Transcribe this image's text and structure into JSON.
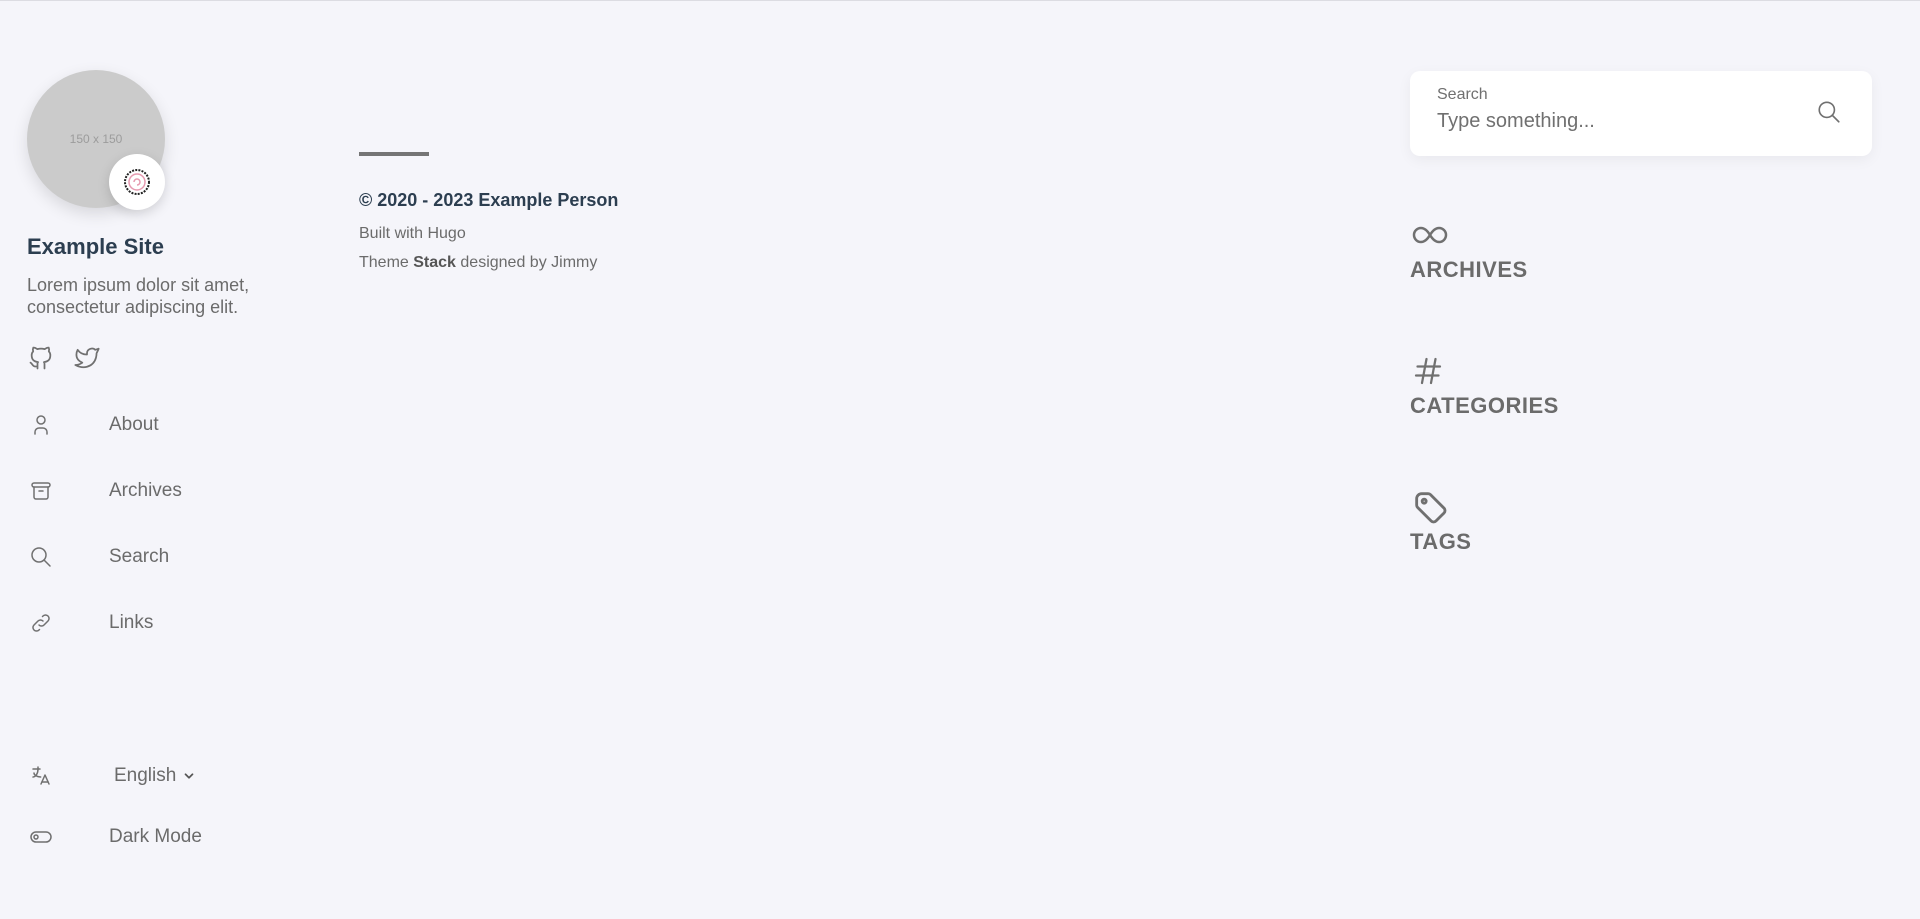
{
  "sidebar": {
    "avatar_placeholder": "150 x 150",
    "emoji_badge": "🍥",
    "site_name": "Example Site",
    "site_description": "Lorem ipsum dolor sit amet, consectetur adipiscing elit.",
    "social": [
      {
        "icon": "github-icon"
      },
      {
        "icon": "twitter-icon"
      }
    ],
    "menu": [
      {
        "label": "About",
        "icon": "user-icon"
      },
      {
        "label": "Archives",
        "icon": "archive-icon"
      },
      {
        "label": "Search",
        "icon": "search-icon"
      },
      {
        "label": "Links",
        "icon": "link-icon"
      }
    ],
    "language": {
      "icon": "language-icon",
      "selected": "English"
    },
    "dark_mode": {
      "icon": "toggle-icon",
      "label": "Dark Mode"
    }
  },
  "footer": {
    "copyright": "© 2020 - 2023 Example Person",
    "built_with": "Built with Hugo",
    "theme_prefix": "Theme ",
    "theme_name": "Stack",
    "theme_suffix": " designed by Jimmy"
  },
  "right": {
    "search": {
      "label": "Search",
      "placeholder": "Type something..."
    },
    "widgets": [
      {
        "title": "ARCHIVES",
        "icon": "infinity-icon"
      },
      {
        "title": "CATEGORIES",
        "icon": "hash-icon"
      },
      {
        "title": "TAGS",
        "icon": "tag-icon"
      }
    ]
  },
  "colors": {
    "background": "#f5f5fa",
    "heading": "#2c3e50",
    "text": "#6b6b6b"
  }
}
